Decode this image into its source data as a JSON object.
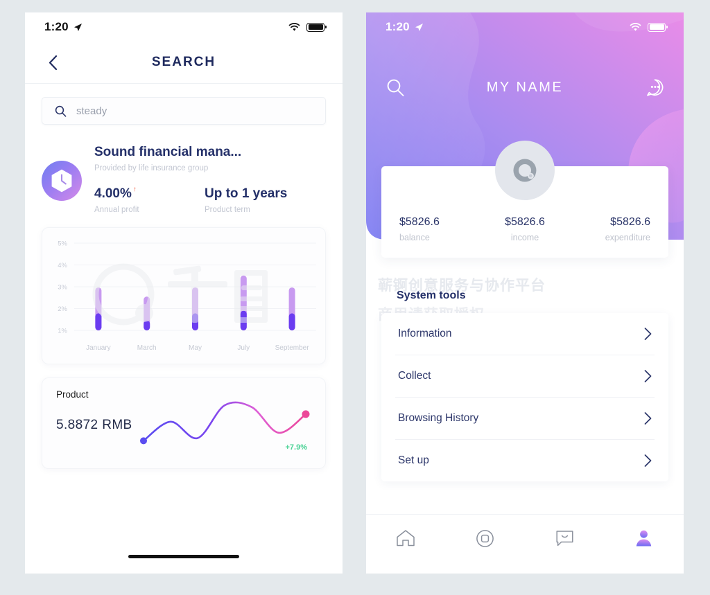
{
  "background_color": "#e4e9ec",
  "accent_colors": {
    "navy": "#243069",
    "purple_dark": "#6b3cf0",
    "purple_light": "#c89af0",
    "pink": "#ec4899",
    "green": "#4ad295",
    "orange": "#f0593c",
    "gradient_start": "#7b7bf0",
    "gradient_end": "#e98ce8"
  },
  "left_screen": {
    "status_bar": {
      "time": "1:20",
      "location_icon": "location-arrow-icon",
      "wifi_icon": "wifi-icon",
      "battery_icon": "battery-icon"
    },
    "nav": {
      "back_icon": "chevron-left-icon",
      "title": "SEARCH"
    },
    "search": {
      "icon": "search-icon",
      "value": "steady",
      "placeholder": "steady"
    },
    "product": {
      "badge_icon": "clock-hexagon-icon",
      "title": "Sound financial mana...",
      "subtitle": "Provided by life insurance group",
      "annual_profit_value": "4.00%",
      "annual_profit_trend": "↑",
      "annual_profit_label": "Annual profit",
      "term_value": "Up to 1 years",
      "term_label": "Product term"
    },
    "line_card": {
      "label": "Product",
      "price": "5.8872  RMB",
      "change": "+7.9%"
    },
    "watermark": "千图"
  },
  "right_screen": {
    "status_bar": {
      "time": "1:20",
      "location_icon": "location-arrow-icon",
      "wifi_icon": "wifi-icon",
      "battery_icon": "battery-icon"
    },
    "hero": {
      "search_icon": "search-icon",
      "title": "MY NAME",
      "message_icon": "chat-bubble-dots-icon",
      "avatar_icon": "avatar-ring-icon"
    },
    "stats": [
      {
        "value": "$5826.6",
        "label": "balance"
      },
      {
        "value": "$5826.6",
        "label": "income"
      },
      {
        "value": "$5826.6",
        "label": "expenditure"
      }
    ],
    "section_title": "System tools",
    "menu": [
      {
        "label": "Information",
        "chevron": "chevron-right-icon"
      },
      {
        "label": "Collect",
        "chevron": "chevron-right-icon"
      },
      {
        "label": "Browsing History",
        "chevron": "chevron-right-icon"
      },
      {
        "label": "Set up",
        "chevron": "chevron-right-icon"
      }
    ],
    "tabs": [
      {
        "name": "home",
        "icon": "home-icon",
        "active": false
      },
      {
        "name": "discover",
        "icon": "circle-square-icon",
        "active": false
      },
      {
        "name": "messages",
        "icon": "chat-icon",
        "active": false
      },
      {
        "name": "profile",
        "icon": "person-icon",
        "active": true
      }
    ],
    "watermark_line1": "蕲锕创意服务与协作平台",
    "watermark_line2": "商用请获取授权"
  },
  "chart_data": [
    {
      "type": "bar",
      "title": "",
      "categories": [
        "January",
        "March",
        "May",
        "July",
        "September"
      ],
      "values": [
        2.97,
        2.55,
        2.97,
        3.52,
        2.97
      ],
      "series": [
        {
          "name": "lower segment top",
          "values": [
            1.78,
            1.45,
            1.78,
            1.9,
            1.78
          ]
        },
        {
          "name": "bar top",
          "values": [
            2.97,
            2.55,
            2.97,
            3.52,
            2.97
          ]
        }
      ],
      "base": 1.0,
      "ytick_labels": [
        "1%",
        "2%",
        "3%",
        "4%",
        "5%"
      ],
      "ylim": [
        1,
        5
      ],
      "xlabel": "",
      "ylabel": "",
      "grid": true,
      "legend": "none",
      "colors": {
        "lower": "#6b3cf0",
        "upper": "#c89af0"
      }
    },
    {
      "type": "line",
      "title": "Product",
      "value_label": "5.8872  RMB",
      "change_label": "+7.9%",
      "x": [
        0,
        1,
        2,
        3,
        4,
        5,
        6
      ],
      "y": [
        0.12,
        0.55,
        0.18,
        0.92,
        0.88,
        0.3,
        0.72
      ],
      "smooth": true,
      "start_point_color": "#5b4df0",
      "end_point_color": "#ec4899",
      "grid": false,
      "legend": "none"
    }
  ]
}
